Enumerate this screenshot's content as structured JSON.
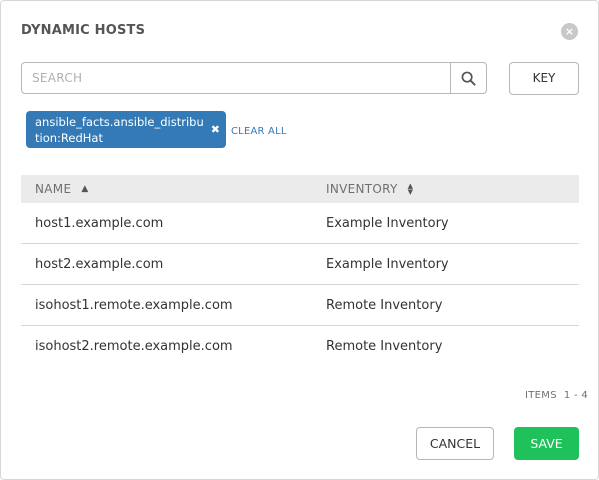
{
  "modal": {
    "title": "DYNAMIC HOSTS",
    "close_icon": "×"
  },
  "search": {
    "placeholder": "SEARCH",
    "value": "",
    "icon": "search-icon",
    "key_label": "KEY"
  },
  "filter_tags": [
    {
      "label": "ansible_facts.ansible_distribution:RedHat",
      "remove_icon": "✖"
    }
  ],
  "clear_all_label": "CLEAR ALL",
  "table": {
    "columns": [
      {
        "label": "NAME",
        "sort": "ascending"
      },
      {
        "label": "INVENTORY",
        "sort": "none"
      }
    ],
    "rows": [
      {
        "name": "host1.example.com",
        "inventory": "Example Inventory"
      },
      {
        "name": "host2.example.com",
        "inventory": "Example Inventory"
      },
      {
        "name": "isohost1.remote.example.com",
        "inventory": "Remote Inventory"
      },
      {
        "name": "isohost2.remote.example.com",
        "inventory": "Remote Inventory"
      }
    ]
  },
  "pagination": {
    "label": "ITEMS",
    "range": "1 - 4"
  },
  "footer": {
    "cancel_label": "CANCEL",
    "save_label": "SAVE"
  },
  "colors": {
    "accent": "#337ab7",
    "save": "#1fc15a",
    "header_bg": "#ebebeb"
  }
}
